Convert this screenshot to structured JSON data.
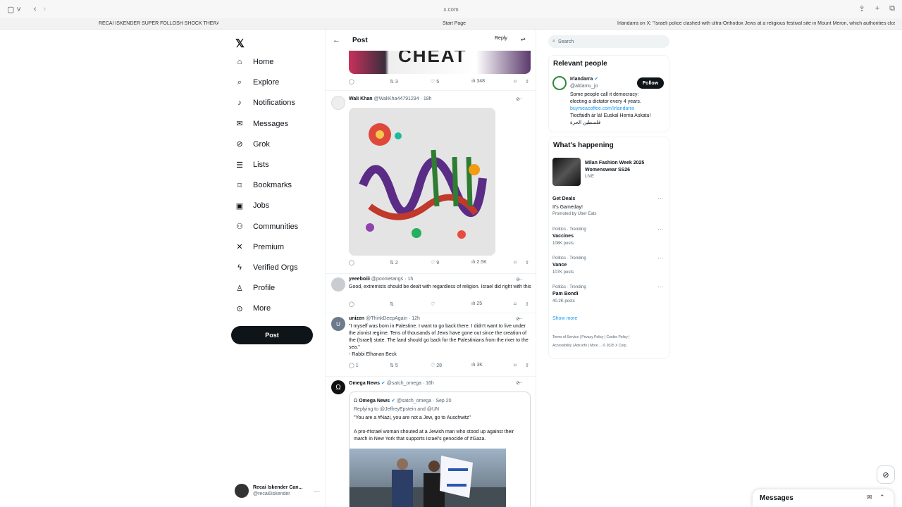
{
  "browser": {
    "url": "x.com",
    "tabs": [
      {
        "title": "RECAI ISKENDER SUPER FOLLOSH SHOCK THERAPY"
      },
      {
        "title": "Start Page"
      },
      {
        "title": "Irlandarra on X: \"Israeli police clashed with ultra-Orthodox Jews at a religious festival site in Mount Meron, which authorities clos..."
      }
    ]
  },
  "nav": {
    "items": [
      {
        "label": "Home",
        "icon": "home-icon",
        "glyph": "⌂"
      },
      {
        "label": "Explore",
        "icon": "search-icon",
        "glyph": "⌕"
      },
      {
        "label": "Notifications",
        "icon": "bell-icon",
        "glyph": "♪"
      },
      {
        "label": "Messages",
        "icon": "envelope-icon",
        "glyph": "✉"
      },
      {
        "label": "Grok",
        "icon": "grok-icon",
        "glyph": "⊘"
      },
      {
        "label": "Lists",
        "icon": "list-icon",
        "glyph": "☰"
      },
      {
        "label": "Bookmarks",
        "icon": "bookmark-icon",
        "glyph": "⌑"
      },
      {
        "label": "Jobs",
        "icon": "briefcase-icon",
        "glyph": "▣"
      },
      {
        "label": "Communities",
        "icon": "people-icon",
        "glyph": "⚇"
      },
      {
        "label": "Premium",
        "icon": "x-logo-icon",
        "glyph": "✕"
      },
      {
        "label": "Verified Orgs",
        "icon": "lightning-icon",
        "glyph": "ϟ"
      },
      {
        "label": "Profile",
        "icon": "person-icon",
        "glyph": "♙"
      },
      {
        "label": "More",
        "icon": "more-circle-icon",
        "glyph": "⊙"
      }
    ],
    "post_label": "Post",
    "account": {
      "name": "Recai Iskender Can...",
      "handle": "@recai0iskender"
    }
  },
  "main": {
    "title": "Post",
    "reply_label": "Reply",
    "top_actions": {
      "retweets": "3",
      "likes": "5",
      "views": "348"
    },
    "sign_text": "CHEAT",
    "tweets": [
      {
        "name": "Wali Khan",
        "handle": "@WaliKha44791294",
        "time": "18h",
        "replies": "",
        "retweets": "2",
        "likes": "9",
        "views": "2.5K"
      },
      {
        "name": "yeeeboiii",
        "handle": "@poonietangs",
        "time": "1h",
        "text": "Good, extremists should be dealt with regardless of religion. Israel did right with this",
        "replies": "",
        "retweets": "",
        "likes": "",
        "views": "25"
      },
      {
        "name": "unizen",
        "handle": "@ThinkDeepAgain",
        "time": "12h",
        "avatar_letter": "U",
        "text": "\"I myself was born in Palestine. I want to go back there. I didn't want to live under the zionist regime. Tens of thousands of Jews have gone out since the creation of the (Israel) state. The land should go back for the Palestinians from the river to the sea.\"",
        "text2": "- Rabbi Elhanan Beck",
        "replies": "1",
        "retweets": "5",
        "likes": "28",
        "views": "3K"
      },
      {
        "name": "Omega News",
        "handle": "@satch_omega",
        "time": "16h",
        "quote": {
          "name": "Omega News",
          "handle": "@satch_omega",
          "date": "Sep 20",
          "replying": "Replying to @JeffreyEpstein and @UN",
          "line1": "\"You are a #Nazi, you are not a Jew, go to Auschwitz\"",
          "line2": "A pro-#Israel woman shouted at a Jewish man who stood up against their march in New York that supports Israel's genocide of #Gaza."
        }
      }
    ]
  },
  "sidebar": {
    "search_placeholder": "Search",
    "relevant_title": "Relevant people",
    "person": {
      "name": "Irlandarra",
      "handle": "@aldamu_jo",
      "bio1": "Some people call it democracy:",
      "bio2": "electing a dictator every 4 years.",
      "link": "buymeacoffee.com/Irlandarra",
      "bio3": "Tiocfaidh ár lá! Euskal Herria Askatu!",
      "bio4": "فلسطين الحرة",
      "follow_label": "Follow"
    },
    "happening_title": "What's happening",
    "event": {
      "title1": "Milan Fashion Week 2025",
      "title2": "Womenswear SS26",
      "status": "LIVE"
    },
    "promo": {
      "title": "Get Deals",
      "sub": "It's Gameday!",
      "by": "Promoted by Uber Eats"
    },
    "trends": [
      {
        "category": "Politics · Trending",
        "name": "Vaccines",
        "count": "108K posts"
      },
      {
        "category": "Politics · Trending",
        "name": "Vance",
        "count": "107K posts"
      },
      {
        "category": "Politics · Trending",
        "name": "Pam Bondi",
        "count": "40.2K posts"
      }
    ],
    "show_more": "Show more",
    "footer1": "Terms of Service  |  Privacy Policy  |  Cookie Policy  |",
    "footer2": "Accessibility  |  Ads info  |  More ...  © 2025 X Corp."
  },
  "messages_bar": {
    "label": "Messages"
  },
  "colors": {
    "accent": "#1d9bf0",
    "text": "#0f1419",
    "muted": "#536471"
  }
}
